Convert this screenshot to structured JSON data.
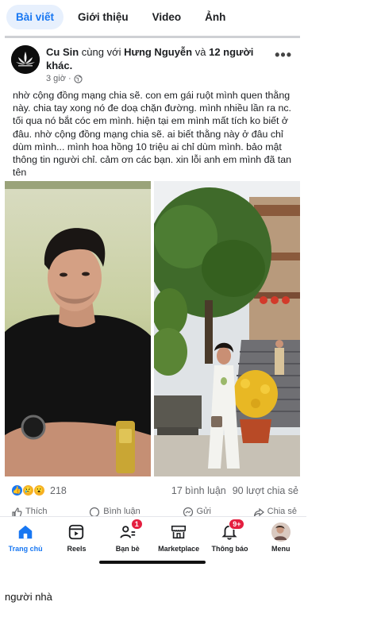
{
  "tabs": [
    {
      "label": "Bài viết",
      "active": true
    },
    {
      "label": "Giới thiệu",
      "active": false
    },
    {
      "label": "Video",
      "active": false
    },
    {
      "label": "Ảnh",
      "active": false
    }
  ],
  "post": {
    "author": "Cu Sin",
    "with_text": "cùng với",
    "tagged": "Hưng Nguyễn",
    "and_text": "và",
    "others": "12 người khác.",
    "time": "3 giờ",
    "privacy_icon": "globe-icon",
    "body": "nhờ cộng đồng mạng chia sẽ. con em gái ruột mình quen thằng này. chia tay xong nó đe doạ chặn đường. mình nhiều lần ra nc. tối qua nó bắt cóc em mình. hiện tại em mình mất tích ko biết ở đâu. nhờ cộng đồng mạng chia sẽ. ai biết thằng này ở đâu chỉ dùm mình... mình hoa hồng 10 triệu ai chỉ dùm mình. bảo mật thông tin người chỉ. cảm ơn các bạn. xin lỗi anh em mình đã tan tên",
    "reaction_count": "218",
    "comments": "17 bình luận",
    "shares": "90 lượt chia sẻ",
    "actions": [
      "Thích",
      "Bình luận",
      "Gửi",
      "Chia sẻ"
    ]
  },
  "bottom_nav": [
    {
      "label": "Trang chủ",
      "icon": "home-icon",
      "active": true,
      "badge": ""
    },
    {
      "label": "Reels",
      "icon": "reels-icon",
      "active": false,
      "badge": ""
    },
    {
      "label": "Bạn bè",
      "icon": "friends-icon",
      "active": false,
      "badge": "1"
    },
    {
      "label": "Marketplace",
      "icon": "marketplace-icon",
      "active": false,
      "badge": ""
    },
    {
      "label": "Thông báo",
      "icon": "bell-icon",
      "active": false,
      "badge": "9+"
    },
    {
      "label": "Menu",
      "icon": "menu-avatar",
      "active": false,
      "badge": ""
    }
  ],
  "caption": "người nhà",
  "colors": {
    "accent": "#1877f2",
    "badge": "#e41e3f"
  }
}
